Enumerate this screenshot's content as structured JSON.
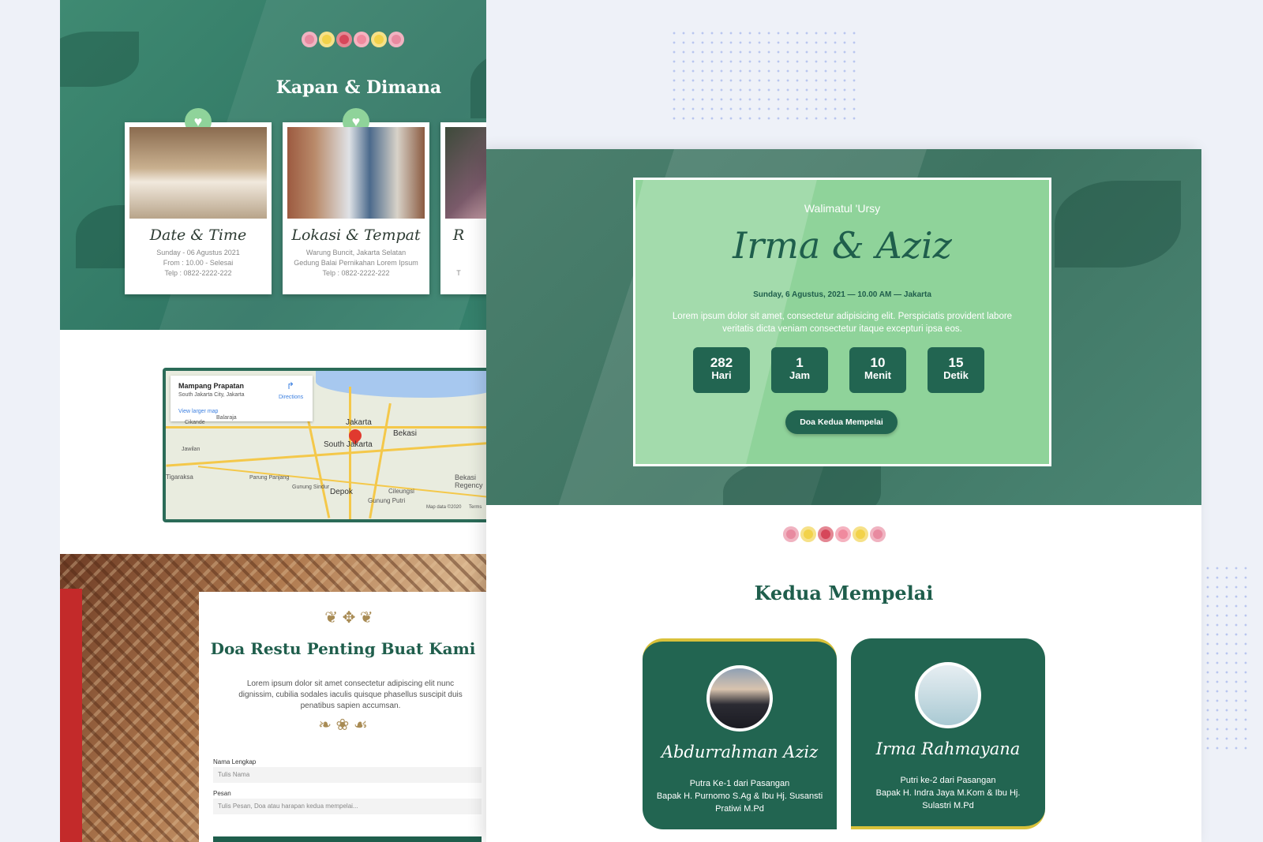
{
  "left": {
    "section_title": "Kapan & Dimana",
    "events": [
      {
        "title": "Date & Time",
        "lines": [
          "Sunday - 06 Agustus 2021",
          "From : 10.00 - Selesai",
          "Telp : 0822-2222-222"
        ]
      },
      {
        "title": "Lokasi & Tempat",
        "lines": [
          "Warung Buncit, Jakarta Selatan",
          "Gedung Balai Pernikahan Lorem Ipsum",
          "Telp : 0822-2222-222"
        ]
      },
      {
        "title": "R",
        "lines": [
          "",
          "",
          "T"
        ]
      }
    ],
    "map": {
      "place_name": "Mampang Prapatan",
      "place_address": "South Jakarta City, Jakarta",
      "directions_label": "Directions",
      "larger_map_link": "View larger map",
      "labels": [
        "Jakarta",
        "South Jakarta",
        "Bekasi",
        "Depok",
        "Cikande",
        "Jawilan",
        "Balaraja",
        "Bekasi Regency",
        "Cileungsi",
        "Gunung Putri",
        "Gunung Sindur",
        "Parung Panjang",
        "Tigaraksa"
      ],
      "footer": "Map data ©2020",
      "terms": "Terms"
    },
    "prayer": {
      "title": "Doa Restu Penting Buat Kami",
      "body": "Lorem ipsum dolor sit amet consectetur adipiscing elit nunc dignissim, cubilia sodales iaculis quisque phasellus suscipit duis penatibus sapien accumsan.",
      "name_label": "Nama Lengkap",
      "name_placeholder": "Tulis Nama",
      "message_label": "Pesan",
      "message_placeholder": "Tulis Pesan, Doa atau harapan kedua mempelai..."
    }
  },
  "hero": {
    "subtitle": "Walimatul 'Ursy",
    "couple": "Irma & Aziz",
    "date_line": "Sunday, 6 Agustus, 2021 — 10.00 AM — Jakarta",
    "description": "Lorem ipsum dolor sit amet, consectetur adipisicing elit. Perspiciatis provident labore veritatis dicta veniam consectetur itaque excepturi ipsa eos.",
    "countdown": [
      {
        "value": "282",
        "unit": "Hari"
      },
      {
        "value": "1",
        "unit": "Jam"
      },
      {
        "value": "10",
        "unit": "Menit"
      },
      {
        "value": "15",
        "unit": "Detik"
      }
    ],
    "button_label": "Doa Kedua Mempelai"
  },
  "couple_section": {
    "title": "Kedua Mempelai",
    "groom": {
      "name": "Abdurrahman Aziz",
      "lines": [
        "Putra Ke-1 dari Pasangan",
        "Bapak H. Purnomo S.Ag & Ibu Hj. Susansti",
        "Pratiwi M.Pd"
      ]
    },
    "bride": {
      "name": "Irma Rahmayana",
      "lines": [
        "Putri ke-2 dari Pasangan",
        "Bapak H. Indra Jaya M.Kom & Ibu Hj.",
        "Sulastri M.Pd"
      ]
    }
  },
  "colors": {
    "primary": "#226551",
    "accent": "#8fd39a",
    "gold": "#d9c13a",
    "background": "#eef1f8"
  },
  "icons": [
    "heart-icon",
    "directions-icon",
    "map-pin-icon",
    "flower-ornament",
    "scroll-ornament"
  ]
}
